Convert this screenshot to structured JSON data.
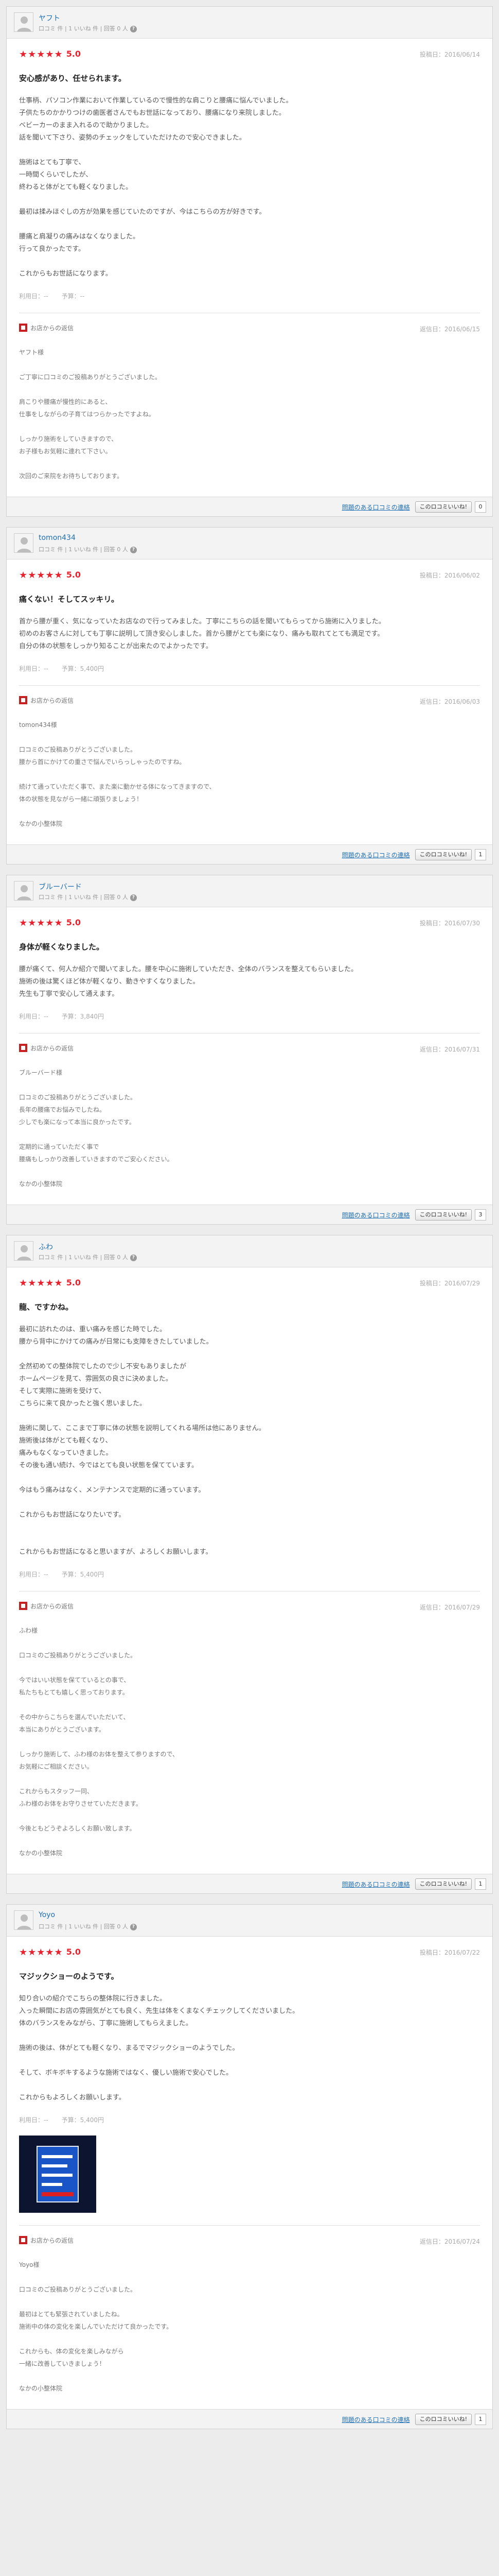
{
  "ui": {
    "reply_label": "お店からの返信",
    "report_label": "問題のある口コミの連絡",
    "helpful_label": "このロコミいいね!",
    "posted_prefix": "投稿日：",
    "visit_prefix": "利用日：",
    "price_prefix": "予算：",
    "star_color": "#e8232f",
    "link_color": "#1f6fb2"
  },
  "reviews": [
    {
      "user": "ヤフト",
      "meta": "口コミ 件 | 1 いいね 件 | 回答 0 人",
      "stars": "★★★★★",
      "score": "5.0",
      "date": "投稿日：2016/06/14",
      "title": "安心感があり、任せられます。",
      "text": "仕事柄、パソコン作業において作業しているので慢性的な肩こりと腰痛に悩んでいました。\n子供たちのかかりつけの歯医者さんでもお世話になっており、腰痛になり来院しました。\nベビーカーのまま入れるので助かりました。\n話を聞いて下さり、姿勢のチェックをしていただけたので安心できました。\n\n施術はとても丁寧で、\n一時間くらいでしたが、\n終わると体がとても軽くなりました。\n\n最初は揉みほぐしの方が効果を感じていたのですが、今はこちらの方が好きです。\n\n腰痛と肩凝りの痛みはなくなりました。\n行って良かったです。\n\nこれからもお世話になります。",
      "visit": "利用日：--",
      "price": "予算：--",
      "photo": false,
      "reply_date": "返信日：2016/06/15",
      "reply_text": "ヤフト様\n\nご丁寧に口コミのご投稿ありがとうございました。\n\n肩こりや腰痛が慢性的にあると、\n仕事をしながらの子育てはつらかったですよね。\n\nしっかり施術をしていきますので、\nお子様もお気軽に連れて下さい。\n\n次回のご来院をお待ちしております。",
      "count": "0"
    },
    {
      "user": "tomon434",
      "meta": "口コミ 件 | 1 いいね 件 | 回答 0 人",
      "stars": "★★★★★",
      "score": "5.0",
      "date": "投稿日：2016/06/02",
      "title": "痛くない！そしてスッキリ。",
      "text": "首から腰が重く、気になっていたお店なので行ってみました。丁寧にこちらの話を聞いてもらってから施術に入りました。\n初めのお客さんに対しても丁寧に説明して頂き安心しました。首から腰がとても楽になり、痛みも取れてとても満足です。\n自分の体の状態をしっかり知ることが出来たのでよかったです。",
      "visit": "利用日：--",
      "price": "予算：5,400円",
      "photo": false,
      "reply_date": "返信日：2016/06/03",
      "reply_text": "tomon434様\n\n口コミのご投稿ありがとうございました。\n腰から首にかけての重さで悩んでいらっしゃったのですね。\n\n続けて通っていただく事で、また楽に動かせる体になってきますので、\n体の状態を見ながら一緒に頑張りましょう！\n\nなかの小整体院",
      "count": "1"
    },
    {
      "user": "ブルーバード",
      "meta": "口コミ 件 | 1 いいね 件 | 回答 0 人",
      "stars": "★★★★★",
      "score": "5.0",
      "date": "投稿日：2016/07/30",
      "title": "身体が軽くなりました。",
      "text": "腰が痛くて、何人か紹介で聞いてました。腰を中心に施術していただき、全体のバランスを整えてもらいました。\n施術の後は驚くほど体が軽くなり、動きやすくなりました。\n先生も丁寧で安心して通えます。",
      "visit": "利用日：--",
      "price": "予算：3,840円",
      "photo": false,
      "reply_date": "返信日：2016/07/31",
      "reply_text": "ブルーバード様\n\n口コミのご投稿ありがとうございました。\n長年の腰痛でお悩みでしたね。\n少しでも楽になって本当に良かったです。\n\n定期的に通っていただく事で\n腰痛もしっかり改善していきますのでご安心ください。\n\nなかの小整体院",
      "count": "3"
    },
    {
      "user": "ふわ",
      "meta": "口コミ 件 | 1 いいね 件 | 回答 0 人",
      "stars": "★★★★★",
      "score": "5.0",
      "date": "投稿日：2016/07/29",
      "title": "龍、ですかね。",
      "text": "最初に訪れたのは、重い痛みを感じた時でした。\n腰から背中にかけての痛みが日常にも支障をきたしていました。\n\n全然初めての整体院でしたので少し不安もありましたが\nホームページを見て、雰囲気の良さに決めました。\nそして実際に施術を受けて、\nこちらに来て良かったと強く思いました。\n\n施術に関して、ここまで丁寧に体の状態を説明してくれる場所は他にありません。\n施術後は体がとても軽くなり、\n痛みもなくなっていきました。\nその後も通い続け、今ではとても良い状態を保てています。\n\n今はもう痛みはなく、メンテナンスで定期的に通っています。\n\nこれからもお世話になりたいです。\n\n\nこれからもお世話になると思いますが、よろしくお願いします。",
      "visit": "利用日：--",
      "price": "予算：5,400円",
      "photo": false,
      "reply_date": "返信日：2016/07/29",
      "reply_text": "ふわ様\n\n口コミのご投稿ありがとうございました。\n\n今ではいい状態を保てているとの事で、\n私たちもとても嬉しく思っております。\n\nその中からこちらを選んでいただいて、\n本当にありがとうございます。\n\nしっかり施術して、ふわ様のお体を整えて参りますので、\nお気軽にご相談ください。\n\nこれからもスタッフ一同、\nふわ様のお体をお守りさせていただきます。\n\n今後ともどうぞよろしくお願い致します。\n\nなかの小整体院",
      "count": "1"
    },
    {
      "user": "Yoyo",
      "meta": "口コミ 件 | 1 いいね 件 | 回答 0 人",
      "stars": "★★★★★",
      "score": "5.0",
      "date": "投稿日：2016/07/22",
      "title": "マジックショーのようです。",
      "text": "知り合いの紹介でこちらの整体院に行きました。\n入った瞬間にお店の雰囲気がとても良く、先生は体をくまなくチェックしてくださいました。\n体のバランスをみながら、丁寧に施術してもらえました。\n\n施術の後は、体がとても軽くなり、まるでマジックショーのようでした。\n\nそして、ボキボキするような施術ではなく、優しい施術で安心でした。\n\nこれからもよろしくお願いします。",
      "visit": "利用日：--",
      "price": "予算：5,400円",
      "photo": true,
      "reply_date": "返信日：2016/07/24",
      "reply_text": "Yoyo様\n\n口コミのご投稿ありがとうございました。\n\n最初はとても緊張されていましたね。\n施術中の体の変化を楽しんでいただけて良かったです。\n\nこれからも、体の変化を楽しみながら\n一緒に改善していきましょう！\n\nなかの小整体院",
      "count": "1"
    }
  ]
}
